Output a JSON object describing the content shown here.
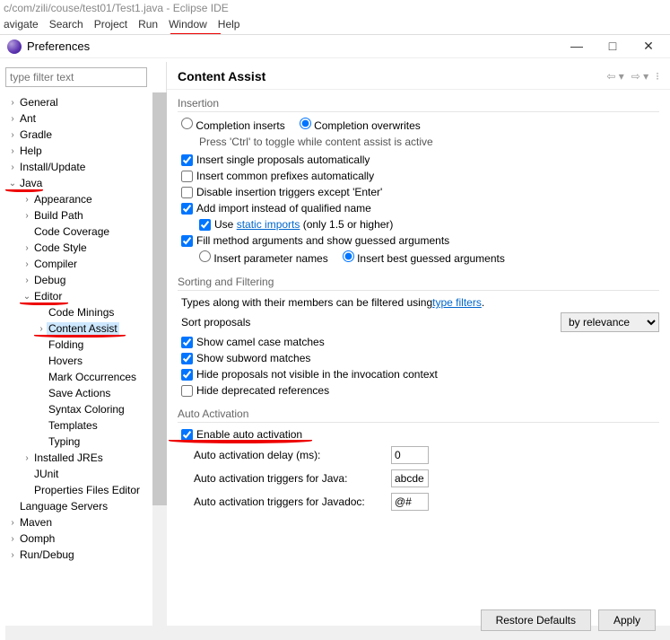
{
  "titlebar_path": "c/com/zili/couse/test01/Test1.java - Eclipse IDE",
  "menubar": [
    "avigate",
    "Search",
    "Project",
    "Run",
    "Window",
    "Help"
  ],
  "dialog_title": "Preferences",
  "filter_placeholder": "type filter text",
  "tree": [
    {
      "t": "General",
      "e": ">",
      "d": 0
    },
    {
      "t": "Ant",
      "e": ">",
      "d": 0
    },
    {
      "t": "Gradle",
      "e": ">",
      "d": 0
    },
    {
      "t": "Help",
      "e": ">",
      "d": 0
    },
    {
      "t": "Install/Update",
      "e": ">",
      "d": 0
    },
    {
      "t": "Java",
      "e": "v",
      "d": 0,
      "red": true
    },
    {
      "t": "Appearance",
      "e": ">",
      "d": 1
    },
    {
      "t": "Build Path",
      "e": ">",
      "d": 1
    },
    {
      "t": "Code Coverage",
      "e": "",
      "d": 1
    },
    {
      "t": "Code Style",
      "e": ">",
      "d": 1
    },
    {
      "t": "Compiler",
      "e": ">",
      "d": 1
    },
    {
      "t": "Debug",
      "e": ">",
      "d": 1
    },
    {
      "t": "Editor",
      "e": "v",
      "d": 1,
      "red": true
    },
    {
      "t": "Code Minings",
      "e": "",
      "d": 2
    },
    {
      "t": "Content Assist",
      "e": ">",
      "d": 2,
      "sel": true,
      "red": true
    },
    {
      "t": "Folding",
      "e": "",
      "d": 2
    },
    {
      "t": "Hovers",
      "e": "",
      "d": 2
    },
    {
      "t": "Mark Occurrences",
      "e": "",
      "d": 2
    },
    {
      "t": "Save Actions",
      "e": "",
      "d": 2
    },
    {
      "t": "Syntax Coloring",
      "e": "",
      "d": 2
    },
    {
      "t": "Templates",
      "e": "",
      "d": 2
    },
    {
      "t": "Typing",
      "e": "",
      "d": 2
    },
    {
      "t": "Installed JREs",
      "e": ">",
      "d": 1
    },
    {
      "t": "JUnit",
      "e": "",
      "d": 1
    },
    {
      "t": "Properties Files Editor",
      "e": "",
      "d": 1
    },
    {
      "t": "Language Servers",
      "e": "",
      "d": 0
    },
    {
      "t": "Maven",
      "e": ">",
      "d": 0
    },
    {
      "t": "Oomph",
      "e": ">",
      "d": 0
    },
    {
      "t": "Run/Debug",
      "e": ">",
      "d": 0
    }
  ],
  "page_title": "Content Assist",
  "insertion": {
    "title": "Insertion",
    "r_inserts": "Completion inserts",
    "r_overwrites": "Completion overwrites",
    "hint": "Press 'Ctrl' to toggle while content assist is active",
    "c1": "Insert single proposals automatically",
    "c2": "Insert common prefixes automatically",
    "c3": "Disable insertion triggers except 'Enter'",
    "c4": "Add import instead of qualified name",
    "c4a_pre": "Use ",
    "c4a_link": "static imports",
    "c4a_post": " (only 1.5 or higher)",
    "c5": "Fill method arguments and show guessed arguments",
    "r_param": "Insert parameter names",
    "r_guess": "Insert best guessed arguments"
  },
  "sorting": {
    "title": "Sorting and Filtering",
    "hint_pre": "Types along with their members can be filtered using ",
    "hint_link": "type filters",
    "hint_post": ".",
    "sort_label": "Sort proposals",
    "sort_value": "by relevance",
    "c1": "Show camel case matches",
    "c2": "Show subword matches",
    "c3": "Hide proposals not visible in the invocation context",
    "c4": "Hide deprecated references"
  },
  "auto": {
    "title": "Auto Activation",
    "c1": "Enable auto activation",
    "f1_label": "Auto activation delay (ms):",
    "f1_value": "0",
    "f2_label": "Auto activation triggers for Java:",
    "f2_value": "abcde",
    "f3_label": "Auto activation triggers for Javadoc:",
    "f3_value": "@#"
  },
  "btn_restore": "Restore Defaults",
  "btn_apply": "Apply"
}
